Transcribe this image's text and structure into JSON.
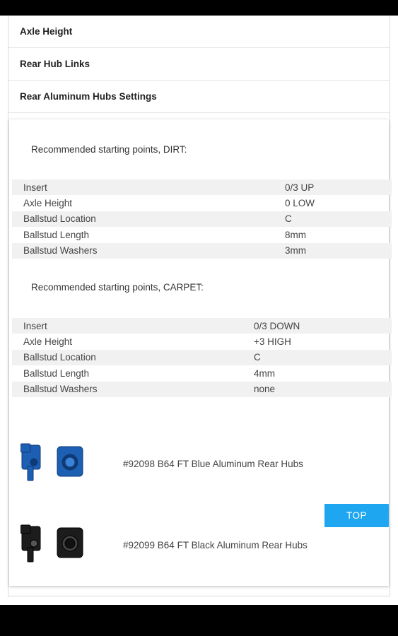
{
  "accordion": {
    "items": [
      {
        "label": "Axle Height"
      },
      {
        "label": "Rear Hub Links"
      },
      {
        "label": "Rear Aluminum Hubs Settings"
      }
    ]
  },
  "dirt": {
    "title": "Recommended starting points, DIRT:",
    "rows": [
      {
        "label": "Insert",
        "value": "0/3 UP"
      },
      {
        "label": "Axle Height",
        "value": "0 LOW"
      },
      {
        "label": "Ballstud Location",
        "value": "C"
      },
      {
        "label": "Ballstud Length",
        "value": "8mm"
      },
      {
        "label": "Ballstud Washers",
        "value": "3mm"
      }
    ]
  },
  "carpet": {
    "title": "Recommended starting points, CARPET:",
    "rows": [
      {
        "label": "Insert",
        "value": "0/3 DOWN"
      },
      {
        "label": "Axle Height",
        "value": "+3 HIGH"
      },
      {
        "label": "Ballstud Location",
        "value": "C"
      },
      {
        "label": "Ballstud Length",
        "value": "4mm"
      },
      {
        "label": "Ballstud Washers",
        "value": "none"
      }
    ]
  },
  "top_button": {
    "label": "TOP"
  },
  "products": [
    {
      "name": "#92098 B64 FT Blue Aluminum Rear Hubs",
      "color": "#1d5fb3"
    },
    {
      "name": "#92099 B64 FT Black Aluminum Rear Hubs",
      "color": "#1c1c1c"
    }
  ],
  "colors": {
    "accent": "#1ea6f0"
  }
}
